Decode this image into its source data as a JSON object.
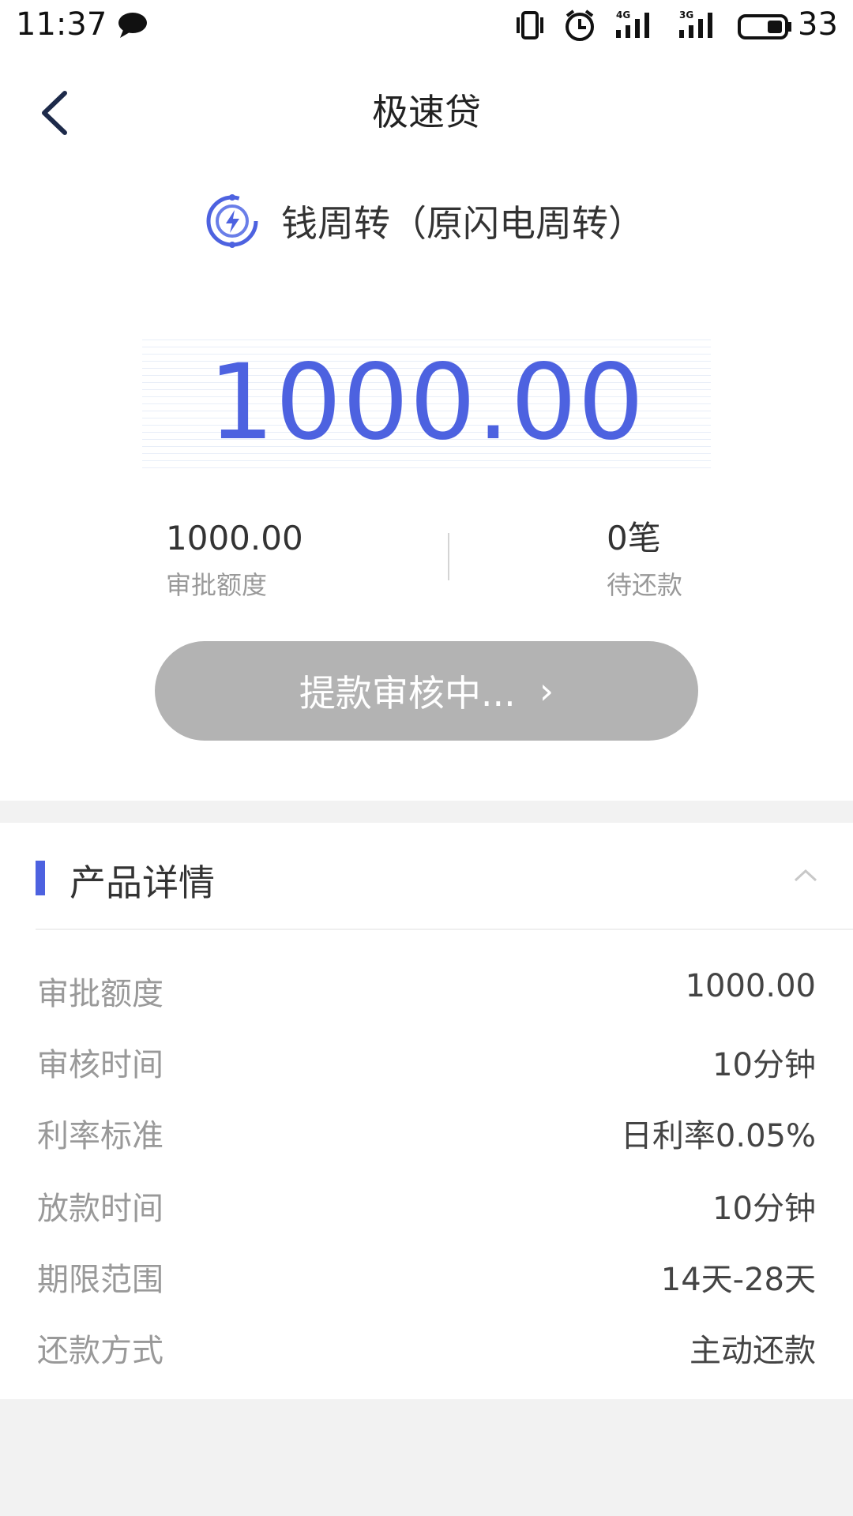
{
  "status_bar": {
    "time": "11:37",
    "net1": "4G",
    "net2": "3G",
    "battery_pct": "33"
  },
  "header": {
    "title": "极速贷",
    "back_icon": "chevron-left-icon"
  },
  "product": {
    "name": "钱周转（原闪电周转）",
    "logo_icon": "lightning-circle-icon",
    "accent_color": "#4d62e0"
  },
  "amount": {
    "value": "1000.00"
  },
  "stats": {
    "approved_value": "1000.00",
    "approved_label": "审批额度",
    "pending_value": "0笔",
    "pending_label": "待还款"
  },
  "action": {
    "label": "提款审核中...",
    "chevron": "›",
    "state_color": "#b3b3b3"
  },
  "details": {
    "title": "产品详情",
    "toggle_icon": "chevron-up-icon",
    "rows": [
      {
        "label": "审批额度",
        "value": "1000.00"
      },
      {
        "label": "审核时间",
        "value": "10分钟"
      },
      {
        "label": "利率标准",
        "value": "日利率0.05%"
      },
      {
        "label": "放款时间",
        "value": "10分钟"
      },
      {
        "label": "期限范围",
        "value": "14天-28天"
      },
      {
        "label": "还款方式",
        "value": "主动还款"
      }
    ]
  }
}
